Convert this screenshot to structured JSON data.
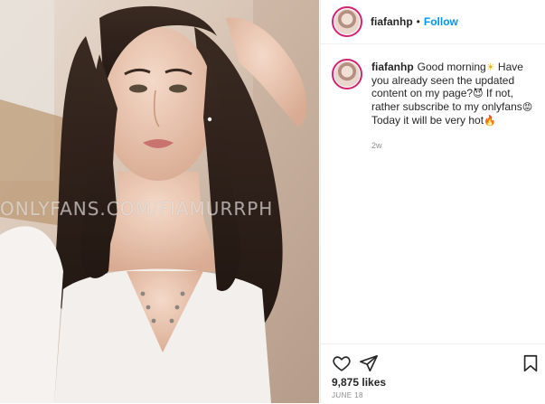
{
  "photo": {
    "alt": "Selfie of a woman with long dark hair in a white ribbed top",
    "watermark": "ONLYFANS.COM/FIAMURRPH"
  },
  "header": {
    "username": "fiafanhp",
    "separator": "•",
    "follow_label": "Follow",
    "accent_color": "#0095f6"
  },
  "caption": {
    "username": "fiafanhp",
    "segments": [
      "Good morning",
      "☀",
      " Have you already seen the updated content on my page?",
      "😈",
      " If not, rather subscribe to my onlyfans",
      "😡",
      " Today it will be very hot",
      "🔥"
    ],
    "time_ago": "2w"
  },
  "actions": {
    "like_icon": "heart-icon",
    "share_icon": "paper-plane-icon",
    "save_icon": "bookmark-icon"
  },
  "likes": {
    "text": "9,875 likes"
  },
  "post_date": "JUNE 18"
}
